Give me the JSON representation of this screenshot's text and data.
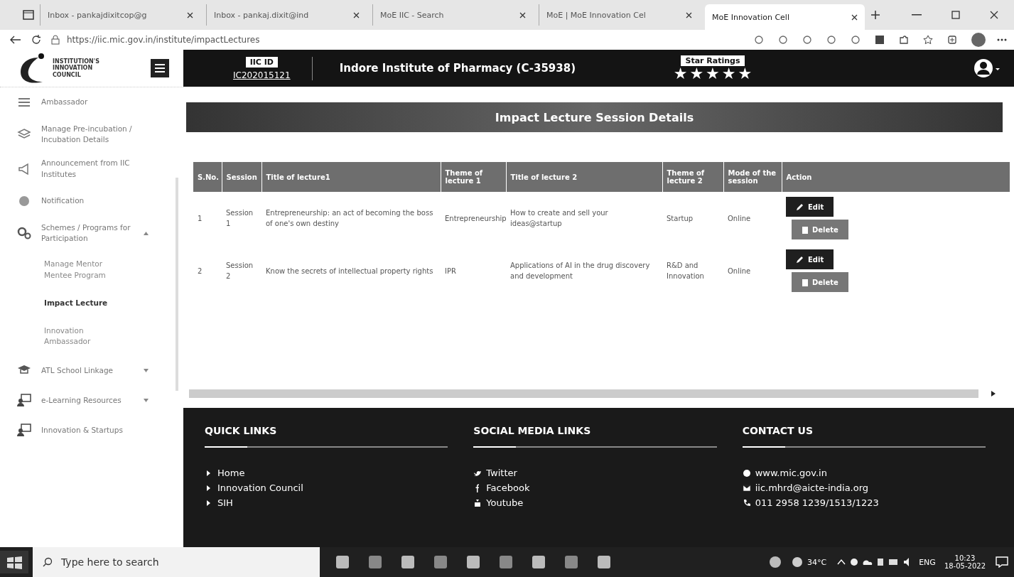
{
  "browser": {
    "tabs": [
      {
        "title": "Inbox - pankajdixitcop@g",
        "selected": false
      },
      {
        "title": "Inbox - pankaj.dixit@ind",
        "selected": false
      },
      {
        "title": "MoE IIC - Search",
        "selected": false
      },
      {
        "title": "MoE | MoE Innovation Cel",
        "selected": false
      },
      {
        "title": "MoE Innovation Cell",
        "selected": true
      }
    ],
    "url": "https://iic.mic.gov.in/institute/impactLectures"
  },
  "header": {
    "logo_text": "INSTITUTION'S INNOVATION COUNCIL",
    "iic_id_label": "IIC ID",
    "iic_id": "IC202015121",
    "institute": "Indore Institute of Pharmacy (C-35938)",
    "star_label": "Star Ratings",
    "stars": 5
  },
  "sidebar": {
    "items": [
      {
        "label": "Ambassador",
        "kind": "item"
      },
      {
        "label": "Manage Pre-incubation / Incubation Details",
        "kind": "item"
      },
      {
        "label": "Announcement from IIC Institutes",
        "kind": "item"
      },
      {
        "label": "Notification",
        "kind": "item"
      },
      {
        "label": "Schemes / Programs for Participation",
        "kind": "group",
        "expanded": true,
        "children": [
          {
            "label": "Manage Mentor Mentee Program",
            "selected": false
          },
          {
            "label": "Impact Lecture",
            "selected": true
          },
          {
            "label": "Innovation Ambassador",
            "selected": false
          }
        ]
      },
      {
        "label": "ATL School Linkage",
        "kind": "group",
        "expanded": false
      },
      {
        "label": "e-Learning Resources",
        "kind": "group",
        "expanded": false
      },
      {
        "label": "Innovation & Startups",
        "kind": "item"
      }
    ]
  },
  "page_title": "Impact Lecture Session Details",
  "table": {
    "columns": [
      "S.No.",
      "Session",
      "Title of lecture1",
      "Theme of lecture 1",
      "Title of lecture 2",
      "Theme of lecture 2",
      "Mode of the session",
      "Action"
    ],
    "rows": [
      {
        "cells": [
          "1",
          "Session 1",
          "Entrepreneurship: an act of becoming the boss of one's own destiny",
          "Entrepreneurship",
          "How to create and sell your ideas@startup",
          "Startup",
          "Online"
        ],
        "actions": [
          "Edit",
          "Delete"
        ]
      },
      {
        "cells": [
          "2",
          "Session 2",
          "Know the secrets of intellectual property rights",
          "IPR",
          "Applications of AI in the drug discovery and development",
          "R&D and Innovation",
          "Online"
        ],
        "actions": [
          "Edit",
          "Delete"
        ]
      }
    ]
  },
  "footer": {
    "sections": [
      {
        "heading": "QUICK LINKS",
        "links": [
          "Home",
          "Innovation Council",
          "SIH"
        ]
      },
      {
        "heading": "SOCIAL MEDIA LINKS",
        "links": [
          "Twitter",
          "Facebook",
          "Youtube"
        ]
      },
      {
        "heading": "CONTACT US",
        "links": [
          "www.mic.gov.in",
          "iic.mhrd@aicte-india.org",
          "011 2958 1239/1513/1223"
        ]
      }
    ]
  },
  "taskbar": {
    "search_placeholder": "Type here to search",
    "temperature": "34°C",
    "language": "ENG",
    "time": "10:23",
    "date": "18-05-2022"
  }
}
